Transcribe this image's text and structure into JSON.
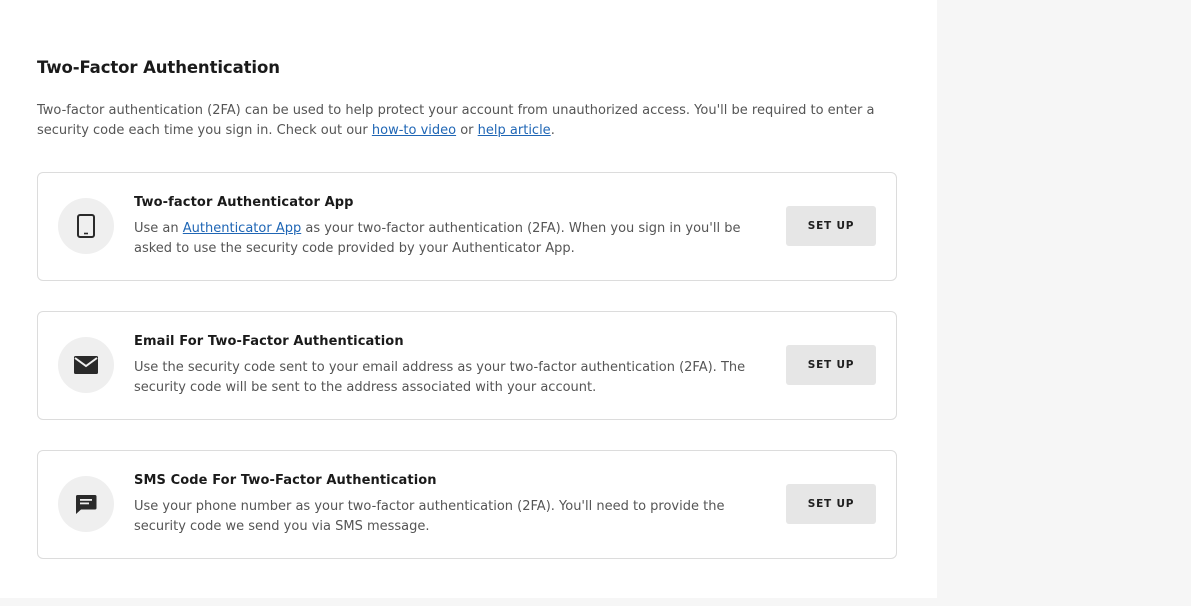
{
  "section": {
    "title": "Two-Factor Authentication",
    "intro_text": "Two-factor authentication (2FA) can be used to help protect your account from unauthorized access. You'll be required to enter a security code each time you sign in. Check out our ",
    "intro_link1": "how-to video",
    "intro_or": " or ",
    "intro_link2": "help article",
    "intro_end": "."
  },
  "methods": [
    {
      "title": "Two-factor Authenticator App",
      "desc_pre": "Use an ",
      "desc_link": "Authenticator App",
      "desc_post": " as your two-factor authentication (2FA). When you sign in you'll be asked to use the security code provided by your Authenticator App.",
      "button": "SET UP",
      "icon": "phone-icon"
    },
    {
      "title": "Email For Two-Factor Authentication",
      "desc": "Use the security code sent to your email address as your two-factor authentication (2FA). The security code will be sent to the address associated with your account.",
      "button": "SET UP",
      "icon": "envelope-icon"
    },
    {
      "title": "SMS Code For Two-Factor Authentication",
      "desc": "Use your phone number as your two-factor authentication (2FA). You'll need to provide the security code we send you via SMS message.",
      "button": "SET UP",
      "icon": "chat-bubble-icon"
    }
  ]
}
